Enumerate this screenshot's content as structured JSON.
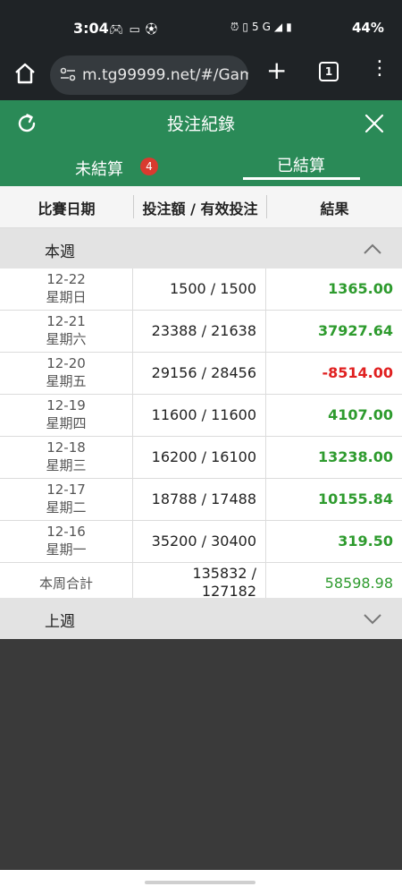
{
  "status": {
    "time": "3:04",
    "left_icons": [
      "game-controller-icon",
      "image-icon",
      "soccer-ball-icon"
    ],
    "right_icons": [
      "alarm-icon",
      "auto-icon",
      "vibrate-icon",
      "lte-icon",
      "5g-icon",
      "signal-icon",
      "battery-icon"
    ],
    "net": "5G",
    "battery": "44%"
  },
  "browser": {
    "url": "m.tg99999.net/#/Gam",
    "tab_count": "1"
  },
  "modal": {
    "title": "投注紀錄",
    "tabs": {
      "unsettled": "未結算",
      "unsettled_badge": "4",
      "settled": "已結算"
    },
    "columns": {
      "date": "比賽日期",
      "amount": "投注額 / 有效投注",
      "result": "結果"
    }
  },
  "this_week": {
    "label": "本週",
    "rows": [
      {
        "date": "12-22",
        "weekday": "星期日",
        "amount": "1500 / 1500",
        "result": "1365.00",
        "status": "pos"
      },
      {
        "date": "12-21",
        "weekday": "星期六",
        "amount": "23388 / 21638",
        "result": "37927.64",
        "status": "pos"
      },
      {
        "date": "12-20",
        "weekday": "星期五",
        "amount": "29156 / 28456",
        "result": "-8514.00",
        "status": "neg"
      },
      {
        "date": "12-19",
        "weekday": "星期四",
        "amount": "11600 / 11600",
        "result": "4107.00",
        "status": "pos"
      },
      {
        "date": "12-18",
        "weekday": "星期三",
        "amount": "16200 / 16100",
        "result": "13238.00",
        "status": "pos"
      },
      {
        "date": "12-17",
        "weekday": "星期二",
        "amount": "18788 / 17488",
        "result": "10155.84",
        "status": "pos"
      },
      {
        "date": "12-16",
        "weekday": "星期一",
        "amount": "35200 / 30400",
        "result": "319.50",
        "status": "pos"
      }
    ],
    "total": {
      "label": "本周合計",
      "amount_line1": "135832 /",
      "amount_line2": "127182",
      "result": "58598.98"
    }
  },
  "last_week": {
    "label": "上週"
  }
}
